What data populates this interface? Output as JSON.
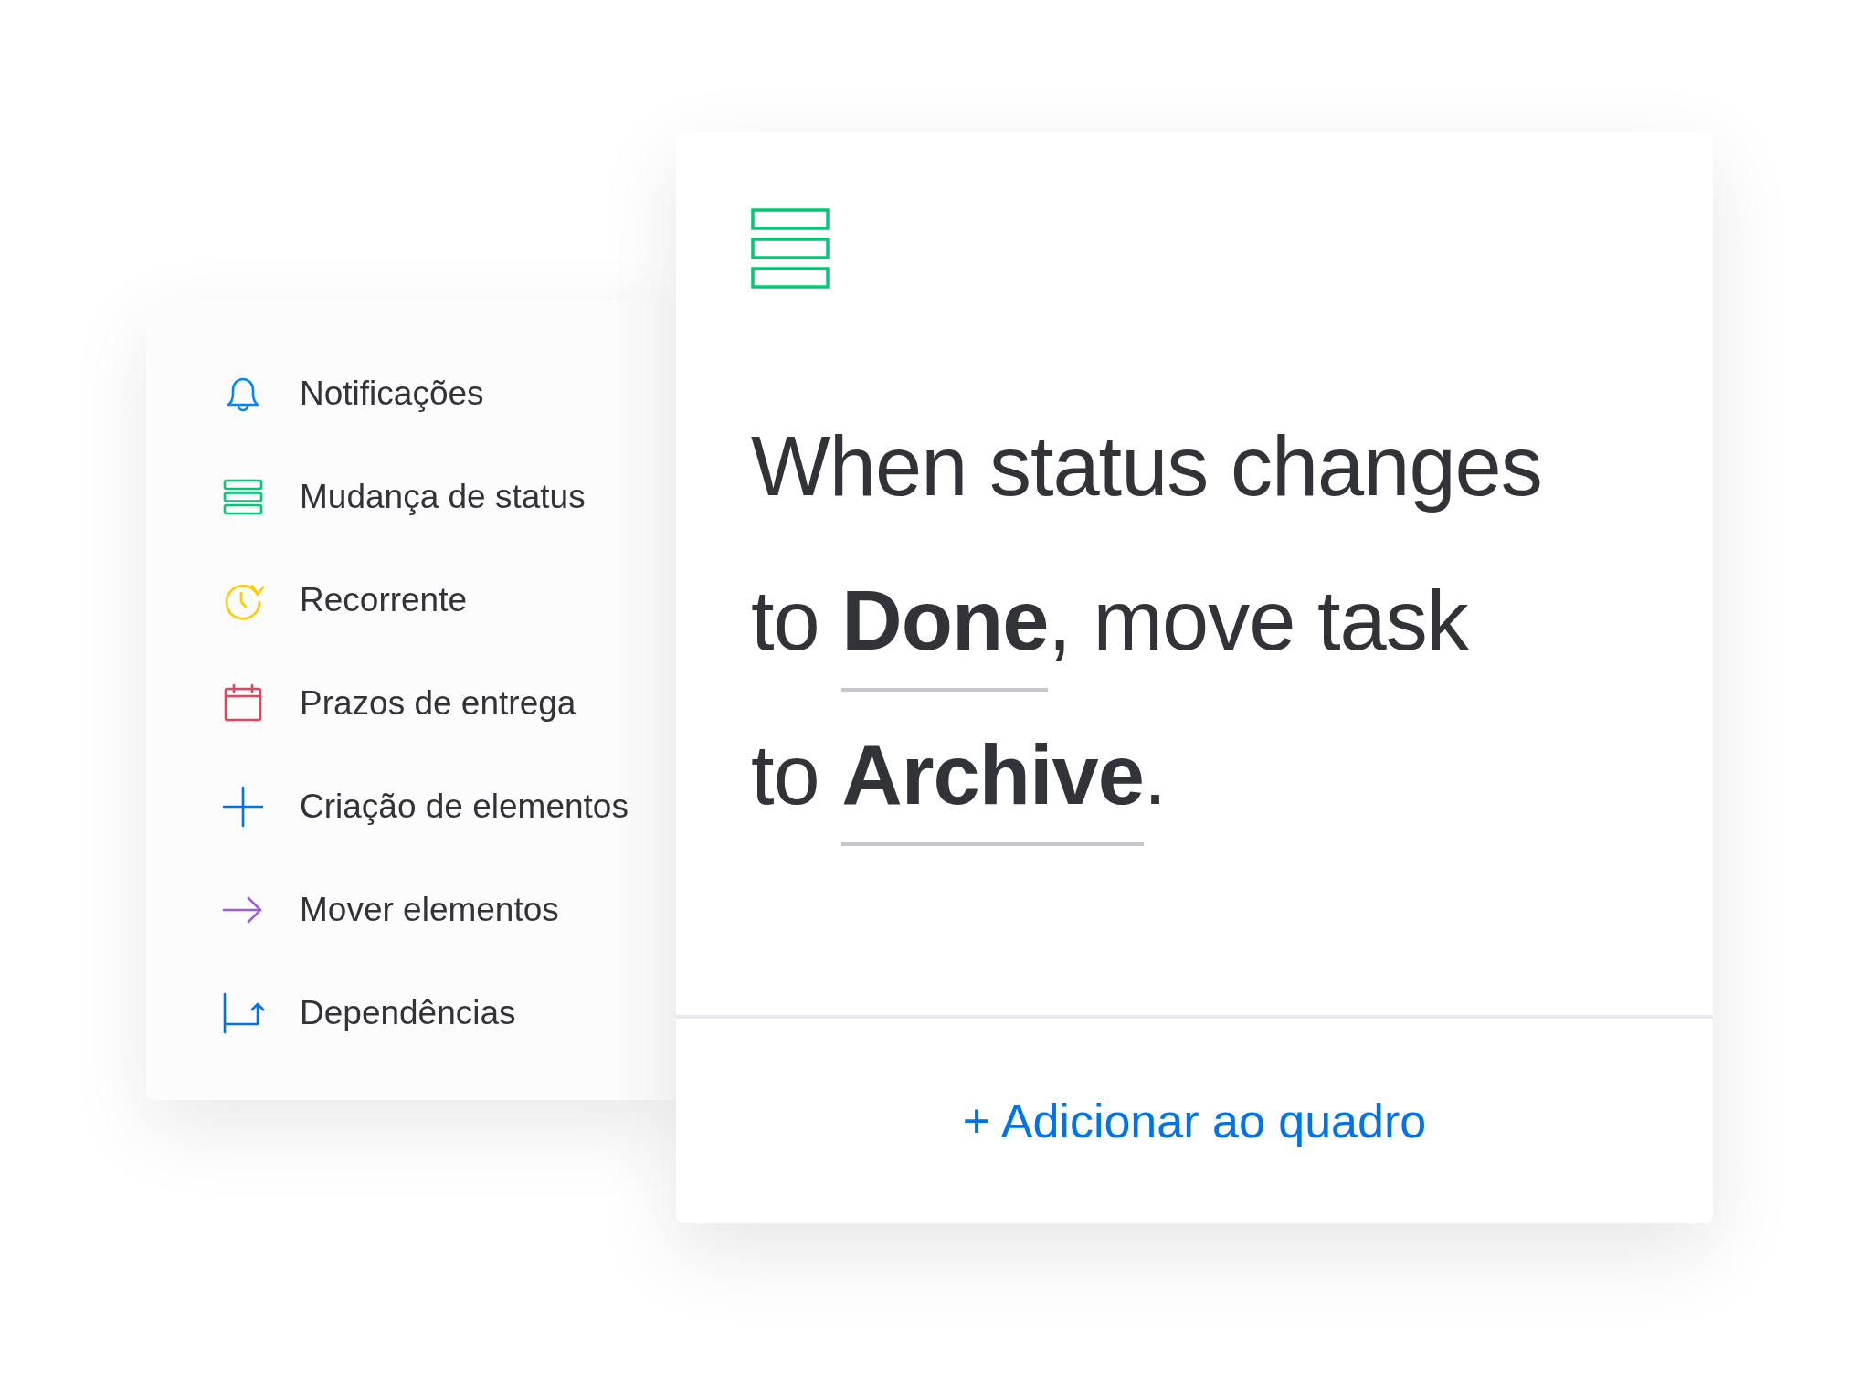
{
  "triggers": [
    {
      "kind": "bell",
      "label": "Notificações"
    },
    {
      "kind": "status",
      "label": "Mudança de status"
    },
    {
      "kind": "recurring",
      "label": "Recorrente"
    },
    {
      "kind": "calendar",
      "label": "Prazos de entrega"
    },
    {
      "kind": "plus",
      "label": "Criação de elementos"
    },
    {
      "kind": "arrow",
      "label": "Mover elementos"
    },
    {
      "kind": "dependency",
      "label": "Dependências"
    }
  ],
  "rule_card": {
    "lines": [
      [
        {
          "kind": "text",
          "text": "When status changes"
        }
      ],
      [
        {
          "kind": "text",
          "text": "to "
        },
        {
          "kind": "field",
          "text": "Done"
        },
        {
          "kind": "text",
          "text": ", move task"
        }
      ],
      [
        {
          "kind": "text",
          "text": "to "
        },
        {
          "kind": "field",
          "text": "Archive"
        },
        {
          "kind": "text",
          "text": "."
        }
      ]
    ],
    "add_button": "+ Adicionar ao quadro"
  }
}
